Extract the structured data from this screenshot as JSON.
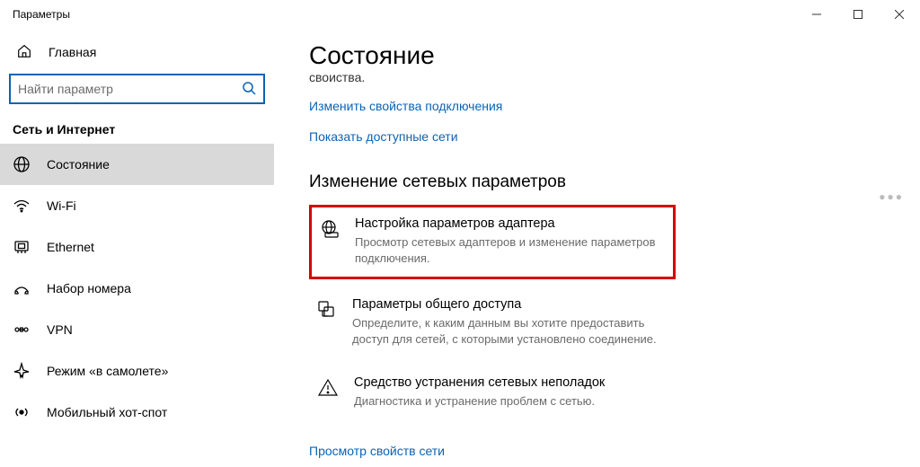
{
  "window": {
    "title": "Параметры"
  },
  "sidebar": {
    "home": "Главная",
    "search_placeholder": "Найти параметр",
    "category": "Сеть и Интернет",
    "items": [
      {
        "label": "Состояние"
      },
      {
        "label": "Wi-Fi"
      },
      {
        "label": "Ethernet"
      },
      {
        "label": "Набор номера"
      },
      {
        "label": "VPN"
      },
      {
        "label": "Режим «в самолете»"
      },
      {
        "label": "Мобильный хот-спот"
      }
    ]
  },
  "main": {
    "title": "Состояние",
    "cut_text": "своиства.",
    "link_change": "Изменить свойства подключения",
    "link_show": "Показать доступные сети",
    "section": "Изменение сетевых параметров",
    "opts": [
      {
        "title": "Настройка параметров адаптера",
        "desc": "Просмотр сетевых адаптеров и изменение параметров подключения."
      },
      {
        "title": "Параметры общего доступа",
        "desc": "Определите, к каким данным вы хотите предоставить доступ для сетей, с которыми установлено соединение."
      },
      {
        "title": "Средство устранения сетевых неполадок",
        "desc": "Диагностика и устранение проблем с сетью."
      }
    ],
    "link_props": "Просмотр свойств сети"
  }
}
